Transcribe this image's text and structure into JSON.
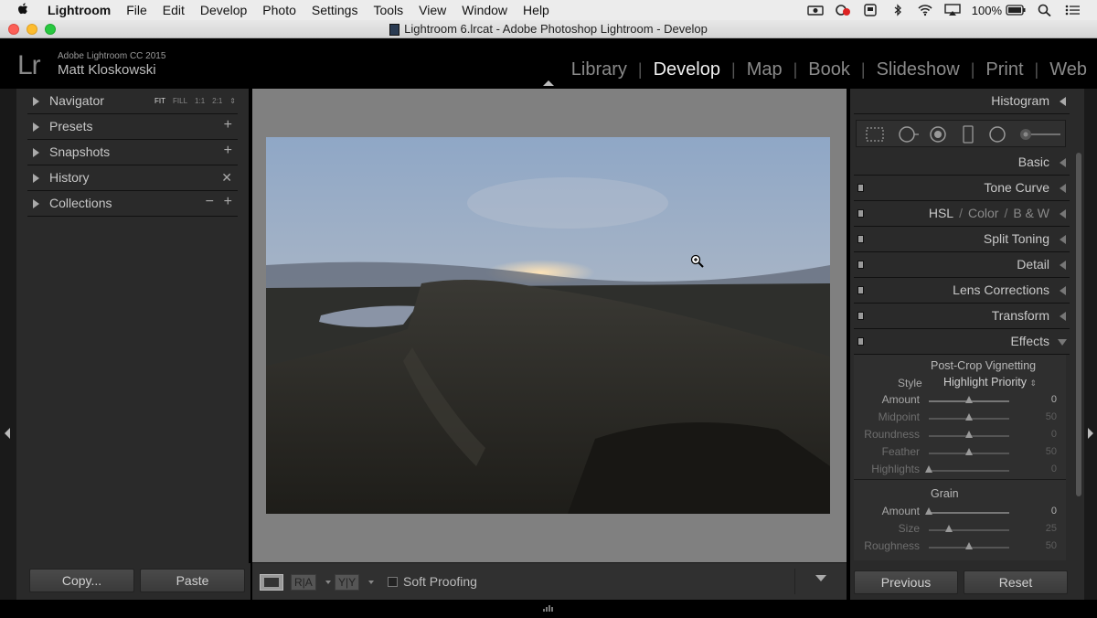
{
  "macos_menubar": {
    "app_name": "Lightroom",
    "items": [
      "File",
      "Edit",
      "Develop",
      "Photo",
      "Settings",
      "Tools",
      "View",
      "Window",
      "Help"
    ],
    "battery": "100%"
  },
  "window": {
    "title": "Lightroom 6.lrcat - Adobe Photoshop Lightroom - Develop"
  },
  "identity": {
    "logo": "Lr",
    "version": "Adobe Lightroom CC 2015",
    "user": "Matt Kloskowski"
  },
  "modules": {
    "items": [
      "Library",
      "Develop",
      "Map",
      "Book",
      "Slideshow",
      "Print",
      "Web"
    ],
    "active": "Develop"
  },
  "left_panel": {
    "navigator": {
      "label": "Navigator",
      "options": [
        "FIT",
        "FILL",
        "1:1",
        "2:1"
      ],
      "selected": "FIT"
    },
    "presets": {
      "label": "Presets"
    },
    "snapshots": {
      "label": "Snapshots"
    },
    "history": {
      "label": "History"
    },
    "collections": {
      "label": "Collections"
    },
    "buttons": {
      "copy": "Copy...",
      "paste": "Paste"
    }
  },
  "toolbar": {
    "soft_proofing": "Soft Proofing",
    "ra_label": "R|A",
    "yy_label": "Y|Y"
  },
  "right_panel": {
    "histogram": "Histogram",
    "panels": [
      "Basic",
      "Tone Curve",
      "Split Toning",
      "Detail",
      "Lens Corrections",
      "Transform",
      "Effects"
    ],
    "hsl": {
      "hsl": "HSL",
      "color": "Color",
      "bw": "B & W"
    },
    "effects": {
      "vignette_title": "Post-Crop Vignetting",
      "style_label": "Style",
      "style_value": "Highlight Priority",
      "vignette_sliders": [
        {
          "label": "Amount",
          "value": "0",
          "fraction": 0.5
        },
        {
          "label": "Midpoint",
          "value": "50",
          "fraction": 0.5
        },
        {
          "label": "Roundness",
          "value": "0",
          "fraction": 0.5
        },
        {
          "label": "Feather",
          "value": "50",
          "fraction": 0.5
        },
        {
          "label": "Highlights",
          "value": "0",
          "fraction": 0.0
        }
      ],
      "grain_title": "Grain",
      "grain_sliders": [
        {
          "label": "Amount",
          "value": "0",
          "fraction": 0.0
        },
        {
          "label": "Size",
          "value": "25",
          "fraction": 0.25
        },
        {
          "label": "Roughness",
          "value": "50",
          "fraction": 0.5
        }
      ]
    },
    "buttons": {
      "previous": "Previous",
      "reset": "Reset"
    }
  },
  "colors": {
    "panel_bg": "#2a2a2a",
    "canvas_bg": "#808080",
    "text": "#c8c8c8",
    "active_module": "#efefef"
  }
}
